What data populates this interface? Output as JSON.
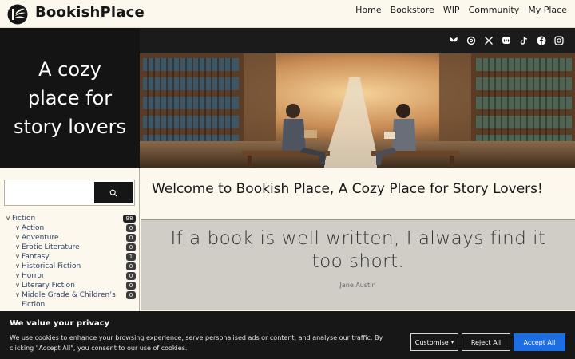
{
  "header": {
    "brand": "BookishPlace",
    "nav": [
      "Home",
      "Bookstore",
      "WIP",
      "Community",
      "My Place"
    ]
  },
  "hero": {
    "tagline": "A cozy place for story lovers",
    "social_icons": [
      "bluesky-icon",
      "threads-icon",
      "x-icon",
      "mastodon-icon",
      "tiktok-icon",
      "facebook-icon",
      "instagram-icon"
    ]
  },
  "sidebar": {
    "search": {
      "placeholder": "",
      "button_icon": "search-icon"
    },
    "categories": [
      {
        "label": "Fiction",
        "count": "98",
        "level": 0
      },
      {
        "label": "Action",
        "count": "0",
        "level": 1
      },
      {
        "label": "Adventure",
        "count": "0",
        "level": 1
      },
      {
        "label": "Erotic Literature",
        "count": "0",
        "level": 1
      },
      {
        "label": "Fantasy",
        "count": "1",
        "level": 1
      },
      {
        "label": "Historical Fiction",
        "count": "0",
        "level": 1
      },
      {
        "label": "Horror",
        "count": "0",
        "level": 1
      },
      {
        "label": "Literary Fiction",
        "count": "0",
        "level": 1
      },
      {
        "label": "Middle Grade & Children’s Fiction",
        "count": "0",
        "level": 1
      }
    ]
  },
  "main": {
    "welcome": "Welcome to Bookish Place, A Cozy Place for Story Lovers!",
    "quote": "If a book is well written, I always find it too short.",
    "quote_author": "Jane Austin"
  },
  "cookie_banner": {
    "title": "We value your privacy",
    "text": "We use cookies to enhance your browsing experience, serve personalised ads or content, and analyse our traffic. By clicking \"Accept All\", you consent to our use of cookies.",
    "customise": "Customise",
    "reject": "Reject All",
    "accept": "Accept All"
  },
  "colors": {
    "accent": "#1d6ee3",
    "dark": "#141414",
    "background": "#fdf8ee",
    "quote_bg": "#d0ccc6"
  }
}
